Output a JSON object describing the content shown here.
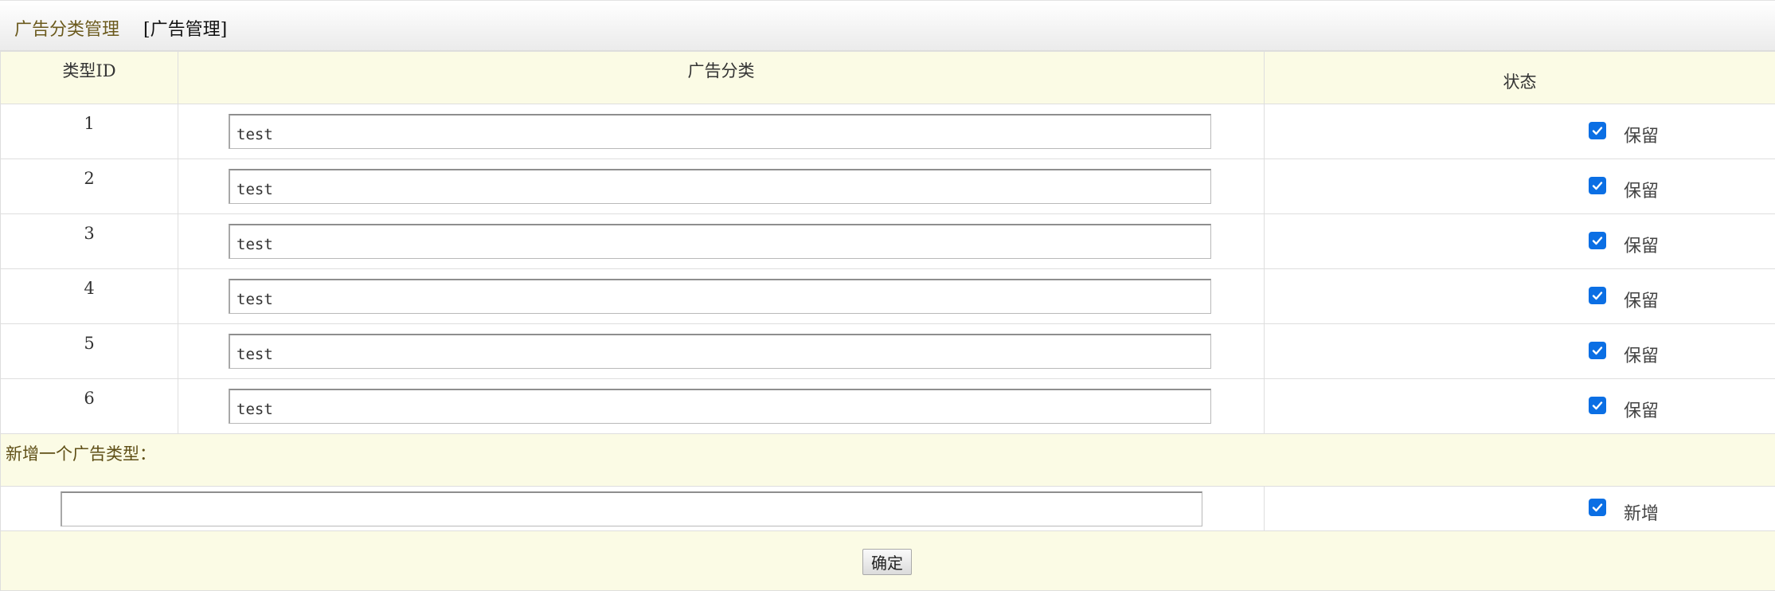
{
  "header": {
    "title": "广告分类管理",
    "crumb": "[广告管理]"
  },
  "table": {
    "columns": [
      "类型ID",
      "广告分类",
      "状态"
    ],
    "rows": [
      {
        "id": "1",
        "name": "test",
        "checked": true,
        "state_label": "保留"
      },
      {
        "id": "2",
        "name": "test",
        "checked": true,
        "state_label": "保留"
      },
      {
        "id": "3",
        "name": "test",
        "checked": true,
        "state_label": "保留"
      },
      {
        "id": "4",
        "name": "test",
        "checked": true,
        "state_label": "保留"
      },
      {
        "id": "5",
        "name": "test",
        "checked": true,
        "state_label": "保留"
      },
      {
        "id": "6",
        "name": "test",
        "checked": true,
        "state_label": "保留"
      }
    ]
  },
  "add_section": {
    "title": "新增一个广告类型：",
    "input_value": "",
    "checked": true,
    "state_label": "新增"
  },
  "submit_label": "确定",
  "colors": {
    "accent": "#0b6fe4",
    "header_bg": "#fbfbe5",
    "title_text": "#6b5a1d"
  }
}
